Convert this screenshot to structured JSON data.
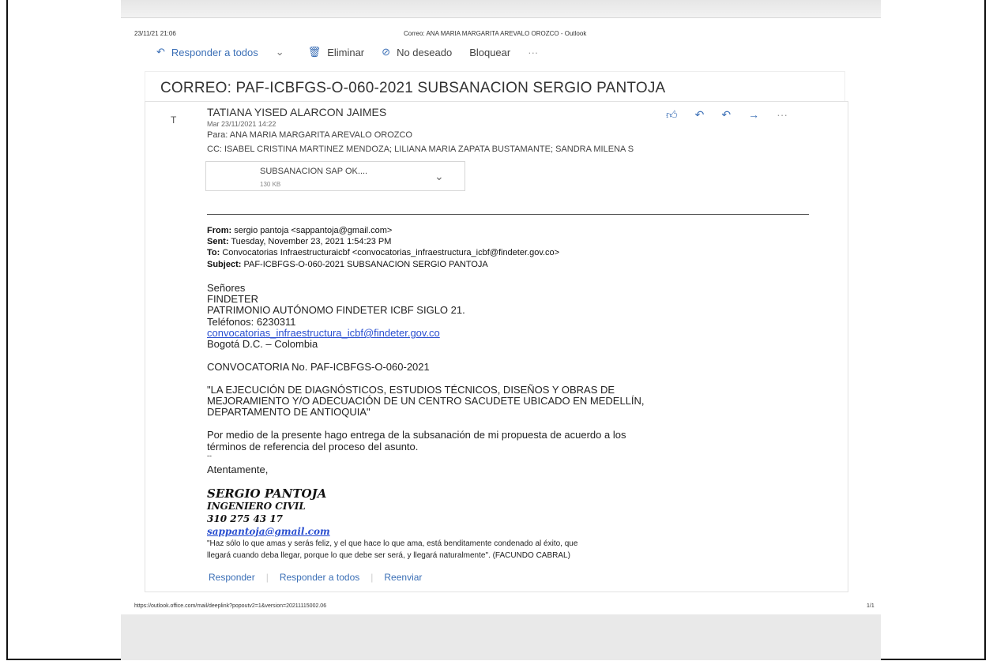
{
  "print_header": {
    "datetime": "23/11/21 21:06",
    "title": "Correo: ANA MARIA MARGARITA AREVALO OROZCO - Outlook"
  },
  "toolbar": {
    "reply_all": "Responder a todos",
    "delete": "Eliminar",
    "junk": "No deseado",
    "block": "Bloquear",
    "more": "···"
  },
  "subject": "CORREO: PAF-ICBFGS-O-060-2021 SUBSANACION SERGIO PANTOJA",
  "message": {
    "avatar_initial": "T",
    "sender": "TATIANA YISED ALARCON JAIMES",
    "date": "Mar 23/11/2021 14:22",
    "to": "Para: ANA MARIA MARGARITA AREVALO OROZCO",
    "cc": "CC: ISABEL CRISTINA MARTINEZ MENDOZA; LILIANA MARIA ZAPATA BUSTAMANTE; SANDRA MILENA S",
    "attachment": {
      "name": "SUBSANACION SAP OK....",
      "size": "130 KB"
    }
  },
  "forwarded": {
    "from_label": "From:",
    "from": "sergio pantoja <sappantoja@gmail.com>",
    "sent_label": "Sent:",
    "sent": "Tuesday, November 23, 2021 1:54:23 PM",
    "to_label": "To:",
    "to": "Convocatorias Infraestructuraicbf <convocatorias_infraestructura_icbf@findeter.gov.co>",
    "subject_label": "Subject:",
    "subject": "PAF-ICBFGS-O-060-2021 SUBSANACION SERGIO PANTOJA"
  },
  "body": {
    "salutation": "Señores",
    "org1": "FINDETER",
    "org2": "PATRIMONIO AUTÓNOMO FINDETER ICBF SIGLO 21.",
    "phone": "Teléfonos: 6230311",
    "email_link": "convocatorias_infraestructura_icbf@findeter.gov.co",
    "city": "Bogotá D.C. – Colombia",
    "convocatoria": "CONVOCATORIA No. PAF-ICBFGS-O-060-2021",
    "project1": "\"LA EJECUCIÓN DE DIAGNÓSTICOS, ESTUDIOS TÉCNICOS, DISEÑOS Y OBRAS DE",
    "project2": "MEJORAMIENTO Y/O ADECUACIÓN DE UN CENTRO SACUDETE UBICADO EN MEDELLÍN,",
    "project3": "DEPARTAMENTO DE ANTIOQUIA\"",
    "para1": "Por medio de la presente hago entrega de la subsanación de mi propuesta de acuerdo a los",
    "para2": "términos de referencia  del proceso del asunto.",
    "dashes": "--",
    "closing": "Atentamente,"
  },
  "signature": {
    "name": "SERGIO PANTOJA",
    "role": "INGENIERO CIVIL",
    "phone": "310 275 43 17",
    "email": "sappantoja@gmail.com",
    "quote1": "\"Haz sólo lo que amas y serás feliz, y el que hace lo que ama, está benditamente condenado al éxito, que",
    "quote2": "llegará cuando deba llegar, porque lo que debe ser será, y llegará naturalmente\". (FACUNDO CABRAL)"
  },
  "footer_actions": {
    "reply": "Responder",
    "reply_all": "Responder a todos",
    "forward": "Reenviar"
  },
  "print_footer": {
    "url": "https://outlook.office.com/mail/deeplink?popoutv2=1&version=20211115002.06",
    "page": "1/1"
  }
}
